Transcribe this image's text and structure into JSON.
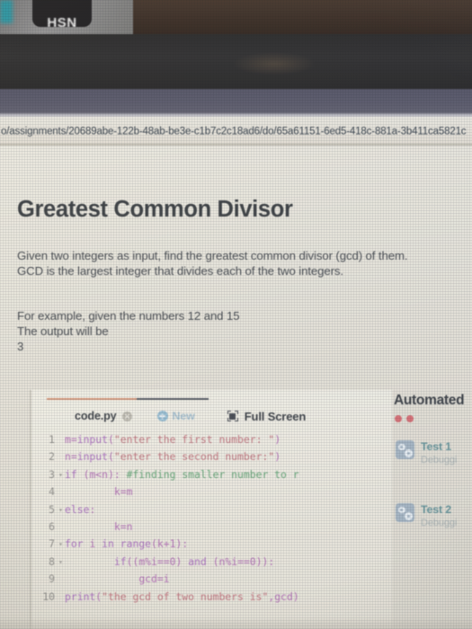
{
  "photo": {
    "wall_badge_text": "HSN"
  },
  "browser": {
    "url": "o/assignments/20689abe-122b-48ab-be3e-c1b7c2c18ad6/do/65a61151-6ed5-418c-881a-3b411ca5821c"
  },
  "page": {
    "title": "Greatest Common Divisor",
    "description_line1": "Given two integers as input, find the greatest common divisor (gcd) of them.",
    "description_line2": "GCD is the largest integer that divides each of the two integers.",
    "example_line1": "For example, given the numbers 12 and 15",
    "example_line2": "The output will be",
    "example_line3": "3"
  },
  "editor": {
    "tab_name": "code.py",
    "close_icon": "close-circle-icon",
    "new_label": "New",
    "new_icon": "plus-circle-icon",
    "fullscreen_label": "Full Screen",
    "fullscreen_icon": "fullscreen-icon",
    "lines": [
      {
        "n": "1",
        "fold": "",
        "code": "m=input(\"enter the first number: \")"
      },
      {
        "n": "2",
        "fold": "",
        "code": "n=input(\"enter the second number:\")"
      },
      {
        "n": "3",
        "fold": "▾",
        "code": "if (m<n): #finding smaller number to r"
      },
      {
        "n": "4",
        "fold": "",
        "code": "        k=m"
      },
      {
        "n": "5",
        "fold": "▾",
        "code": "else:"
      },
      {
        "n": "6",
        "fold": "",
        "code": "        k=n"
      },
      {
        "n": "7",
        "fold": "▾",
        "code": "for i in range(k+1):"
      },
      {
        "n": "8",
        "fold": "▾",
        "code": "        if((m%i==0) and (n%i==0)):"
      },
      {
        "n": "9",
        "fold": "",
        "code": "            gcd=i"
      },
      {
        "n": "10",
        "fold": "",
        "code": "print(\"the gcd of two numbers is\",gcd)"
      }
    ]
  },
  "tests_panel": {
    "title": "Automated",
    "status_dots": 2,
    "status_dot_color": "#d4666c",
    "items": [
      {
        "name": "Test 1",
        "sub": "Debuggi",
        "icon": "gears-icon"
      },
      {
        "name": "Test 2",
        "sub": "Debuggi",
        "icon": "gears-icon"
      }
    ]
  },
  "colors": {
    "accent_teal": "#5d8e94",
    "accent_blue": "#9fbccd",
    "title_dark": "#2e3338",
    "code_keyword": "#a86bbd",
    "code_string": "#c0707a",
    "code_comment": "#5ea271"
  }
}
